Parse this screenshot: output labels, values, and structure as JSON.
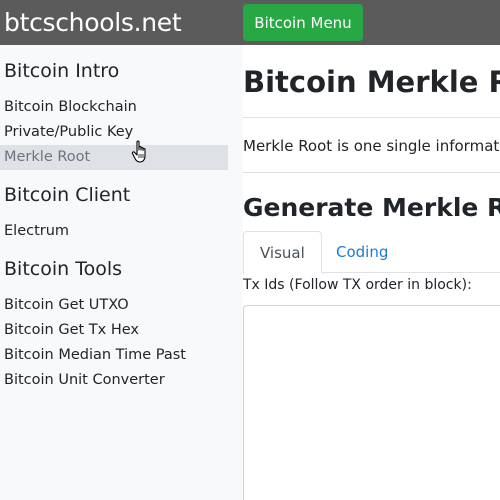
{
  "header": {
    "brand": "btcschools.net",
    "menu_button": "Bitcoin Menu"
  },
  "sidebar": {
    "sections": [
      {
        "title": "Bitcoin Intro",
        "items": [
          "Bitcoin Blockchain",
          "Private/Public Key",
          "Merkle Root"
        ]
      },
      {
        "title": "Bitcoin Client",
        "items": [
          "Electrum"
        ]
      },
      {
        "title": "Bitcoin Tools",
        "items": [
          "Bitcoin Get UTXO",
          "Bitcoin Get Tx Hex",
          "Bitcoin Median Time Past",
          "Bitcoin Unit Converter"
        ]
      }
    ],
    "active_item": "Merkle Root"
  },
  "main": {
    "title": "Bitcoin Merkle Ro",
    "intro": "Merkle Root is one single informatio",
    "subtitle": "Generate Merkle Roo",
    "tabs": [
      "Visual",
      "Coding"
    ],
    "active_tab": "Visual",
    "field_label": "Tx Ids (Follow TX order in block):",
    "field_value": ""
  },
  "colors": {
    "topbar": "#5b5b5b",
    "menu_button": "#28a745",
    "sidebar": "#f8f9fa",
    "active_item": "#dee2e6",
    "link": "#1a7bd6"
  }
}
